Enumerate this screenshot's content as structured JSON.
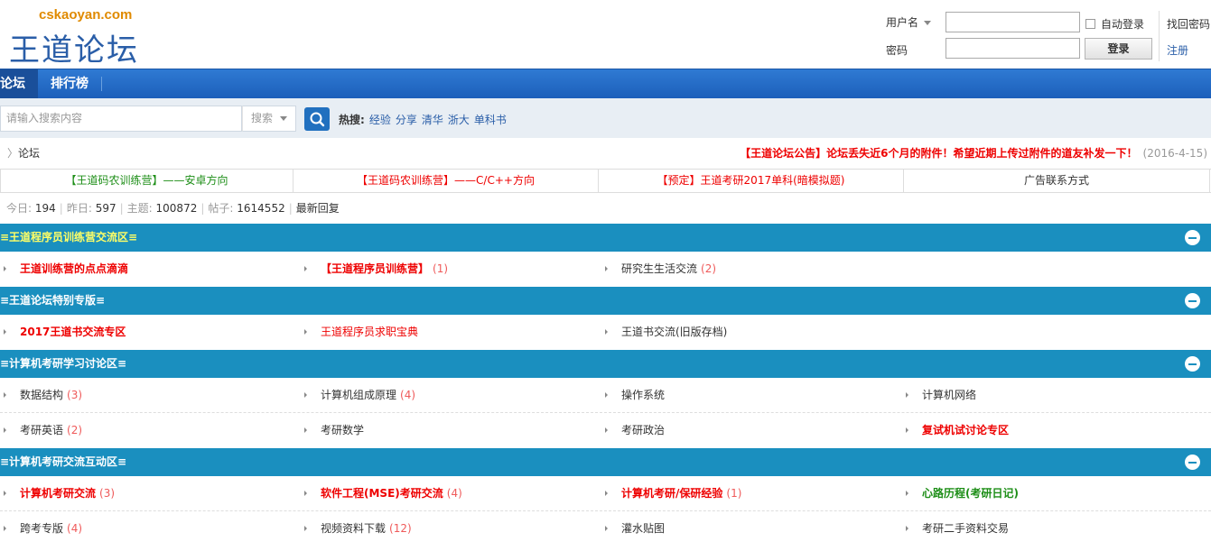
{
  "logo": {
    "domain": "cskaoyan.com",
    "name": "王道论坛"
  },
  "login": {
    "username_label": "用户名",
    "password_label": "密码",
    "auto_login_label": "自动登录",
    "login_button": "登录",
    "forgot_link": "找回密码",
    "register_link": "注册"
  },
  "nav": {
    "items": [
      "论坛",
      "排行榜"
    ]
  },
  "search": {
    "placeholder": "请输入搜索内容",
    "scope": "搜索",
    "hot_label": "热搜:",
    "hot_items": [
      "经验",
      "分享",
      "清华",
      "浙大",
      "单科书"
    ]
  },
  "breadcrumb": {
    "sep": "〉",
    "current": "论坛"
  },
  "announcement": {
    "text": "【王道论坛公告】论坛丢失近6个月的附件！希望近期上传过附件的道友补发一下！",
    "date": "(2016-4-15)"
  },
  "ads": [
    {
      "text": "【王道码农训练营】——安卓方向",
      "color": "#1d8e17"
    },
    {
      "text": "【王道码农训练营】——C/C++方向",
      "color": "#e00"
    },
    {
      "text": "【预定】王道考研2017单科(暗模拟题)",
      "color": "#e00"
    },
    {
      "text": "广告联系方式",
      "color": "#333"
    }
  ],
  "stats": {
    "today_label": "今日:",
    "today": "194",
    "yesterday_label": "昨日:",
    "yesterday": "597",
    "topics_label": "主题:",
    "topics": "100872",
    "posts_label": "帖子:",
    "posts": "1614552",
    "latest_link": "最新回复"
  },
  "sections": [
    {
      "title": "≡王道程序员训练营交流区≡",
      "title_color": "#ffff66",
      "rows": [
        [
          {
            "name": "王道训练营的点点滴滴",
            "count": "",
            "style": "red"
          },
          {
            "name": "【王道程序员训练营】",
            "count": "(1)",
            "style": "red"
          },
          {
            "name": "研究生生活交流",
            "count": "(2)",
            "style": "blk"
          }
        ]
      ]
    },
    {
      "title": "≡王道论坛特别专版≡",
      "title_color": "#ffffff",
      "rows": [
        [
          {
            "name": "2017王道书交流专区",
            "count": "",
            "style": "red"
          },
          {
            "name": "王道程序员求职宝典",
            "count": "",
            "style": "redn"
          },
          {
            "name": "王道书交流(旧版存档)",
            "count": "",
            "style": "blk"
          }
        ]
      ]
    },
    {
      "title": "≡计算机考研学习讨论区≡",
      "title_color": "#ffffff",
      "rows": [
        [
          {
            "name": "数据结构",
            "count": "(3)",
            "style": "blk"
          },
          {
            "name": "计算机组成原理",
            "count": "(4)",
            "style": "blk"
          },
          {
            "name": "操作系统",
            "count": "",
            "style": "blk"
          },
          {
            "name": "计算机网络",
            "count": "",
            "style": "blk"
          }
        ],
        [
          {
            "name": "考研英语",
            "count": "(2)",
            "style": "blk"
          },
          {
            "name": "考研数学",
            "count": "",
            "style": "blk"
          },
          {
            "name": "考研政治",
            "count": "",
            "style": "blk"
          },
          {
            "name": "复试机试讨论专区",
            "count": "",
            "style": "red"
          }
        ]
      ]
    },
    {
      "title": "≡计算机考研交流互动区≡",
      "title_color": "#ffffff",
      "rows": [
        [
          {
            "name": "计算机考研交流",
            "count": "(3)",
            "style": "red"
          },
          {
            "name": "软件工程(MSE)考研交流",
            "count": "(4)",
            "style": "red"
          },
          {
            "name": "计算机考研/保研经验",
            "count": "(1)",
            "style": "red"
          },
          {
            "name": "心路历程(考研日记)",
            "count": "",
            "style": "grn"
          }
        ],
        [
          {
            "name": "跨考专版",
            "count": "(4)",
            "style": "blk"
          },
          {
            "name": "视频资料下载",
            "count": "(12)",
            "style": "blk"
          },
          {
            "name": "灌水贴图",
            "count": "",
            "style": "blk"
          },
          {
            "name": "考研二手资料交易",
            "count": "",
            "style": "blk"
          }
        ]
      ]
    }
  ]
}
